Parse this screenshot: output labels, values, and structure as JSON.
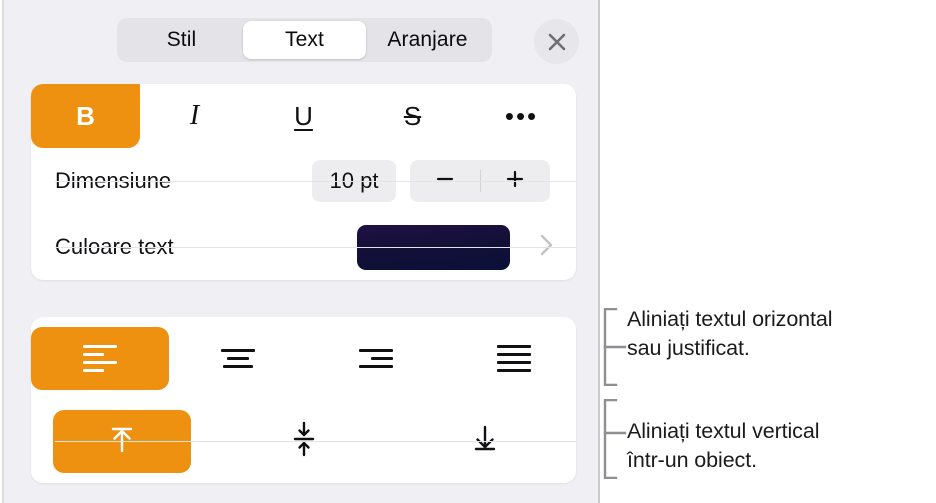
{
  "panel": {
    "tabs": [
      {
        "label": "Stil",
        "selected": false
      },
      {
        "label": "Text",
        "selected": true
      },
      {
        "label": "Aranjare",
        "selected": false
      }
    ],
    "close_label": "×",
    "style_row": {
      "bold": "B",
      "italic": "I",
      "underline": "U",
      "strikethrough": "S",
      "more": "•••"
    },
    "size_row": {
      "label": "Dimensiune",
      "value": "10 pt",
      "decrease": "−",
      "increase": "+"
    },
    "color_row": {
      "label": "Culoare text",
      "swatch_color": "#141038"
    },
    "horizontal_align": [
      {
        "name": "left",
        "selected": true
      },
      {
        "name": "center",
        "selected": false
      },
      {
        "name": "right",
        "selected": false
      },
      {
        "name": "justify",
        "selected": false
      }
    ],
    "vertical_align": [
      {
        "name": "top",
        "selected": true
      },
      {
        "name": "middle",
        "selected": false
      },
      {
        "name": "bottom",
        "selected": false
      }
    ]
  },
  "callouts": [
    {
      "line1": "Aliniați textul orizontal",
      "line2": "sau justificat."
    },
    {
      "line1": "Aliniați textul vertical",
      "line2": "într-un obiect."
    }
  ],
  "colors": {
    "accent": "#ee9111",
    "panel_bg": "#f0f0f4",
    "card_bg": "#ffffff"
  }
}
